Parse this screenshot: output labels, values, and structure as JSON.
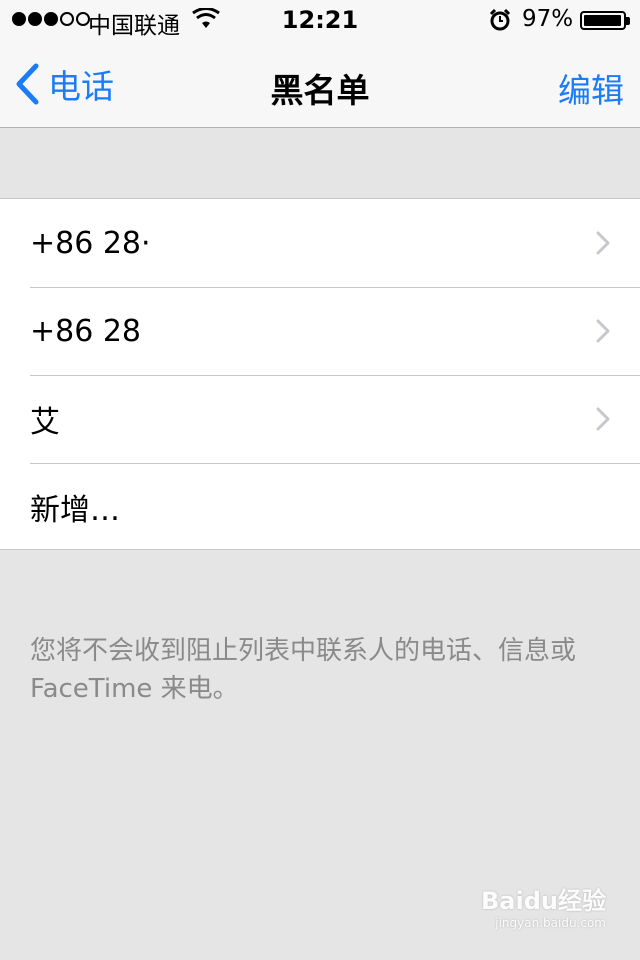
{
  "status_bar": {
    "signal_dots_filled": 3,
    "signal_dots_total": 5,
    "carrier": "中国联通",
    "time": "12:21",
    "battery_percent_text": "97%",
    "battery_level": 0.97,
    "icons": [
      "wifi-icon",
      "alarm-icon",
      "battery-icon"
    ]
  },
  "nav": {
    "back_label": "电话",
    "title": "黑名单",
    "edit_label": "编辑"
  },
  "list": {
    "items": [
      {
        "label": "+86 28·",
        "has_chevron": true
      },
      {
        "label": "+86 28",
        "has_chevron": true
      },
      {
        "label": "艾",
        "has_chevron": true
      },
      {
        "label": "新增…",
        "has_chevron": false
      }
    ]
  },
  "footer": {
    "text": "您将不会收到阻止列表中联系人的电话、信息或 FaceTime 来电。"
  },
  "watermark": {
    "text": "Baidu经验",
    "subtext": "jingyan.baidu.com"
  },
  "colors": {
    "accent": "#1a7cf6",
    "background": "#e5e5e5",
    "bar": "#f7f7f7",
    "footer_text": "#8a8a8a"
  }
}
